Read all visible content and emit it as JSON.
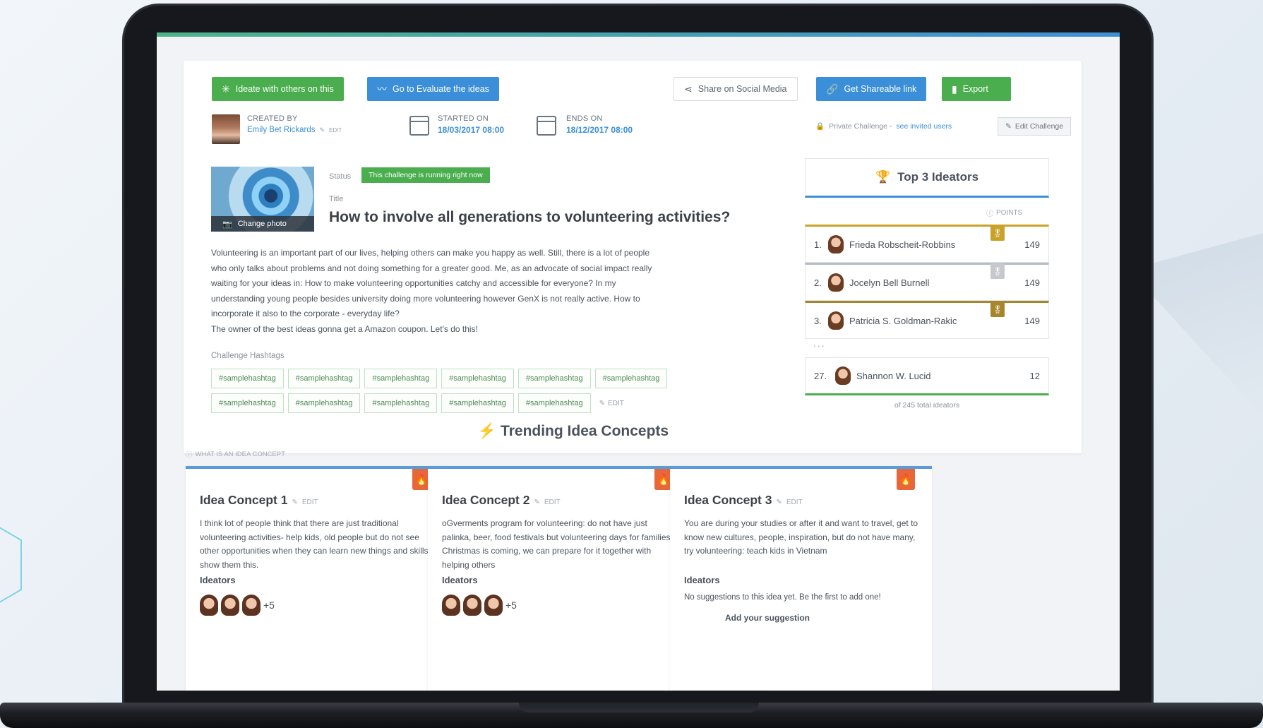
{
  "toolbar": {
    "ideate_label": "Ideate with others on this",
    "evaluate_label": "Go to Evaluate the ideas",
    "share_label": "Share on Social Media",
    "link_label": "Get Shareable link",
    "export_label": "Export"
  },
  "challenge": {
    "created_by_label": "CREATED BY",
    "creator": "Emily Bet Rickards",
    "edit_label": "EDIT",
    "started_label": "STARTED ON",
    "started_value": "18/03/2017 08:00",
    "ends_label": "ENDS ON",
    "ends_value": "18/12/2017 08:00",
    "private_text": "Private Challenge -",
    "private_link": "see invited users",
    "edit_challenge": "Edit Challenge",
    "change_photo": "Change photo",
    "status_label": "Status",
    "status_value": "This challenge is running right now",
    "title_label": "Title",
    "title": "How to involve all generations to volunteering activities?",
    "description": [
      "Volunteering is an important part of our lives, helping others can make you happy as well. Still, there is a lot of people",
      "who only talks about problems and not doing something for a greater good.  Me, as an advocate of social impact really",
      "waiting for your ideas in: How to make volunteering opportunities catchy and accessible for everyone?  In my",
      "understanding young people besides university doing more volunteering however GenX is not really active. How to",
      "incorporate it also to the corporate - everyday life?",
      "The owner of the best ideas gonna get a Amazon coupon.  Let's do this!"
    ],
    "hashtags_label": "Challenge Hashtags",
    "hashtags": [
      "#samplehashtag",
      "#samplehashtag",
      "#samplehashtag",
      "#samplehashtag",
      "#samplehashtag",
      "#samplehashtag",
      "#samplehashtag",
      "#samplehashtag",
      "#samplehashtag",
      "#samplehashtag",
      "#samplehashtag"
    ]
  },
  "ideators": {
    "title": "Top 3 Ideators",
    "points_label": "POINTS",
    "ranks": [
      {
        "num": "1.",
        "name": "Frieda Robscheit-Robbins",
        "points": "149",
        "medal_color": "#c9a227"
      },
      {
        "num": "2.",
        "name": "Jocelyn Bell Burnell",
        "points": "149",
        "medal_color": "#b8bcc2"
      },
      {
        "num": "3.",
        "name": "Patricia S. Goldman-Rakic",
        "points": "149",
        "medal_color": "#a8842a"
      }
    ],
    "dots": "...",
    "self": {
      "num": "27.",
      "name": "Shannon W. Lucid",
      "points": "12"
    },
    "total": "of 245 total ideators"
  },
  "trending": {
    "title": "Trending Idea Concepts",
    "what_label": "WHAT IS AN IDEA CONCEPT",
    "ideators_label": "Ideators",
    "concepts": [
      {
        "title": "Idea Concept 1",
        "edit": "EDIT",
        "desc": "I think lot of people think that there are just traditional volunteering activities- help kids, old people but do not see other opportunities when they can learn new things and skills, show them this.",
        "more": "+5"
      },
      {
        "title": "Idea Concept 2",
        "edit": "EDIT",
        "desc": "oGverments program for volunteering: do not have just palinka, beer, food festivals but volunteering days for families-Christmas is coming, we can prepare for it together with helping others",
        "more": "+5"
      },
      {
        "title": "Idea Concept 3",
        "edit": "EDIT",
        "desc": "You are during your studies or after it and want to travel, get to know new cultures, people, inspiration, but do not have many, try volunteering: teach kids in Vietnam",
        "none": "No suggestions to this idea yet. Be the first to add one!",
        "add": "Add your suggestion"
      }
    ]
  },
  "colors": {
    "green": "#4aae4e",
    "blue": "#3a8fd8",
    "fire": "#e8673a"
  }
}
